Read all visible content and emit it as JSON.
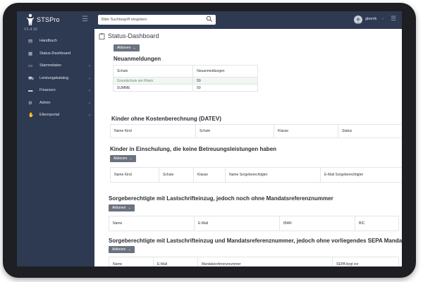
{
  "app": {
    "brand_name": "STSPro",
    "version": "V1.4.10"
  },
  "sidebar": {
    "items": [
      {
        "label": "Handbuch",
        "icon": "book-icon",
        "chevron": false
      },
      {
        "label": "Status-Dashboard",
        "icon": "dashboard-icon",
        "chevron": false
      },
      {
        "label": "Stammdaten",
        "icon": "database-icon",
        "chevron": true
      },
      {
        "label": "Leistungskatalog",
        "icon": "cart-icon",
        "chevron": true
      },
      {
        "label": "Finanzen",
        "icon": "money-icon",
        "chevron": true
      },
      {
        "label": "Admin",
        "icon": "admin-icon",
        "chevron": true
      },
      {
        "label": "Elternportal",
        "icon": "handshake-icon",
        "chevron": true
      }
    ]
  },
  "topbar": {
    "search_placeholder": "Bitte Suchbegriff eingeben",
    "user_name": "gbenik"
  },
  "page": {
    "title": "Status-Dashboard",
    "actions_label": "Aktionen"
  },
  "sections": {
    "neuanmeldungen": {
      "title": "Neuanmeldungen",
      "headers": [
        "Schule",
        "Neuanmeldungen"
      ],
      "rows": [
        [
          "Grundschule am Rhein",
          "59"
        ],
        [
          "SUMME",
          "59"
        ]
      ]
    },
    "kinder_ohne_kosten": {
      "title": "Kinder ohne Kostenberechnung (DATEV)",
      "headers": [
        "Name Kind",
        "Schule",
        "Klasse",
        "Status"
      ]
    },
    "kinder_einschulung": {
      "title": "Kinder in Einschulung, die keine Betreuungsleistungen haben",
      "actions_label": "Aktionen",
      "headers": [
        "Name Kind",
        "Schule",
        "Klasse",
        "Name Sorgeberechtigter",
        "E-Mail Sorgeberechtigter"
      ]
    },
    "lastschrift_ohne_mandat": {
      "title": "Sorgeberechtigte mit Lastschrifteinzug, jedoch noch ohne Mandatsreferenznummer",
      "actions_label": "Aktionen",
      "headers": [
        "Name",
        "E-Mail",
        "IBAN",
        "BIC"
      ]
    },
    "lastschrift_ohne_sepa": {
      "title": "Sorgeberechtigte mit Lastschrifteinzug und Mandatsreferenznummer, jedoch ohne vorliegendes SEPA Mandat",
      "actions_label": "Aktionen",
      "headers": [
        "Name",
        "E-Mail",
        "Mandatsreferenznummer",
        "SEPA liegt vor"
      ]
    }
  },
  "colors": {
    "sidebar": "#2e3952",
    "button": "#6b7380",
    "highlight_row": "#f1f6f1"
  }
}
